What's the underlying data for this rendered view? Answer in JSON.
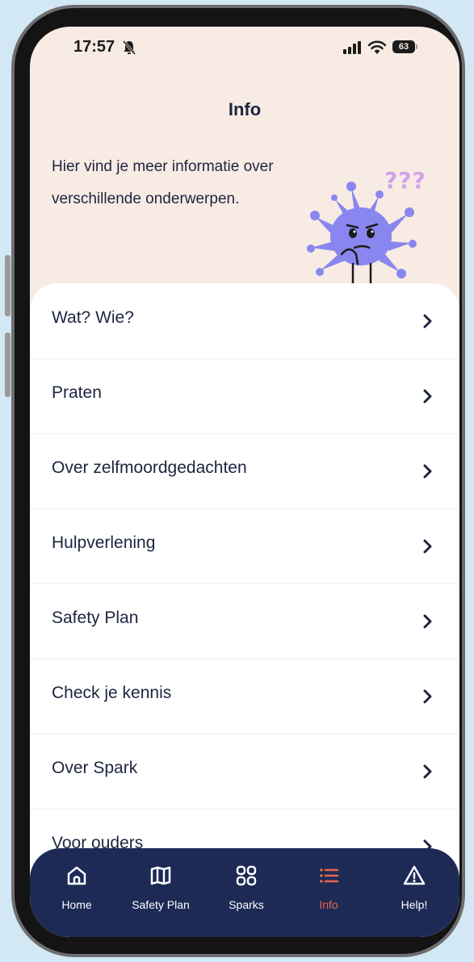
{
  "status_bar": {
    "time": "17:57",
    "battery": "63"
  },
  "header": {
    "title": "Info",
    "intro": "Hier vind je meer informatie over verschillende onderwerpen."
  },
  "mascot": {
    "question_marks": "???",
    "icon": "confused-blob-mascot"
  },
  "menu": {
    "items": [
      {
        "label": "Wat? Wie?"
      },
      {
        "label": "Praten"
      },
      {
        "label": "Over zelfmoordgedachten"
      },
      {
        "label": "Hulpverlening"
      },
      {
        "label": "Safety Plan"
      },
      {
        "label": "Check je kennis"
      },
      {
        "label": "Over Spark"
      },
      {
        "label": "Voor ouders"
      }
    ]
  },
  "navbar": {
    "items": [
      {
        "label": "Home",
        "icon": "home-icon"
      },
      {
        "label": "Safety Plan",
        "icon": "map-icon"
      },
      {
        "label": "Sparks",
        "icon": "grid-icon"
      },
      {
        "label": "Info",
        "icon": "list-icon",
        "active": true
      },
      {
        "label": "Help!",
        "icon": "warning-icon"
      }
    ]
  },
  "colors": {
    "accent": "#e5674d",
    "navy": "#1d2a55",
    "header_bg": "#f8ebe4",
    "mascot": "#8a86ef"
  }
}
